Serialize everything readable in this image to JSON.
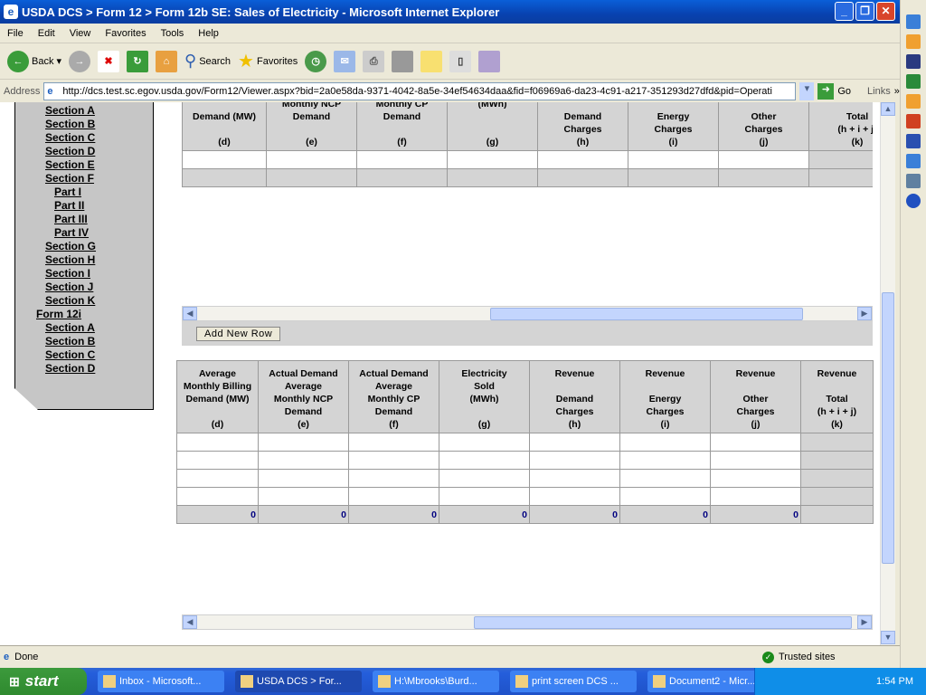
{
  "window": {
    "title": "USDA DCS > Form 12 > Form 12b SE: Sales of Electricity - Microsoft Internet Explorer"
  },
  "menu": [
    "File",
    "Edit",
    "View",
    "Favorites",
    "Tools",
    "Help"
  ],
  "toolbar": {
    "back": "Back",
    "search": "Search",
    "favorites": "Favorites"
  },
  "address": {
    "label": "Address",
    "url": "http://dcs.test.sc.egov.usda.gov/Form12/Viewer.aspx?bid=2a0e58da-9371-4042-8a5e-34ef54634daa&fid=f06969a6-da23-4c91-a217-351293d27dfd&pid=Operati",
    "go": "Go",
    "links": "Links"
  },
  "sidenav": {
    "items": [
      {
        "label": "Section A",
        "level": 1
      },
      {
        "label": "Section B",
        "level": 1
      },
      {
        "label": "Section C",
        "level": 1
      },
      {
        "label": "Section D",
        "level": 1
      },
      {
        "label": "Section E",
        "level": 1
      },
      {
        "label": "Section F",
        "level": 1
      },
      {
        "label": "Part I",
        "level": 2
      },
      {
        "label": "Part II",
        "level": 2
      },
      {
        "label": "Part III",
        "level": 2
      },
      {
        "label": "Part IV",
        "level": 2
      },
      {
        "label": "Section G",
        "level": 1
      },
      {
        "label": "Section H",
        "level": 1
      },
      {
        "label": "Section I",
        "level": 1
      },
      {
        "label": "Section J",
        "level": 1
      },
      {
        "label": "Section K",
        "level": 1
      },
      {
        "label": "Form 12i",
        "level": 0
      },
      {
        "label": "Section A",
        "level": 1
      },
      {
        "label": "Section B",
        "level": 1
      },
      {
        "label": "Section C",
        "level": 1
      },
      {
        "label": "Section D",
        "level": 1
      }
    ]
  },
  "table1": {
    "headers": [
      "Demand (MW)\n\n(d)",
      "Monthly NCP\nDemand\n\n(e)",
      "Monthly CP\nDemand\n\n(f)",
      "(MWh)\n\n\n(g)",
      "Demand\nCharges\n(h)",
      "Energy\nCharges\n(i)",
      "Other\nCharges\n(j)",
      "Total\n(h + i + j)\n(k)"
    ],
    "add_row": "Add New Row"
  },
  "table2": {
    "headers": [
      "Average\nMonthly Billing\nDemand (MW)\n\n(d)",
      "Actual Demand\nAverage\nMonthly NCP\nDemand\n(e)",
      "Actual Demand\nAverage\nMonthly CP\nDemand\n(f)",
      "Electricity\nSold\n(MWh)\n\n(g)",
      "Revenue\n\nDemand\nCharges\n(h)",
      "Revenue\n\nEnergy\nCharges\n(i)",
      "Revenue\n\nOther\nCharges\n(j)",
      "Revenue\n\nTotal\n(h + i + j)\n(k)"
    ],
    "totals": [
      "0",
      "0",
      "0",
      "0",
      "0",
      "0",
      "0",
      ""
    ]
  },
  "status": {
    "text": "Done",
    "zone": "Trusted sites"
  },
  "taskbar": {
    "start": "start",
    "tasks": [
      "Inbox - Microsoft...",
      "USDA DCS > For...",
      "H:\\Mbrooks\\Burd...",
      "print screen DCS ...",
      "Document2 - Micr..."
    ],
    "clock": "1:54 PM"
  }
}
